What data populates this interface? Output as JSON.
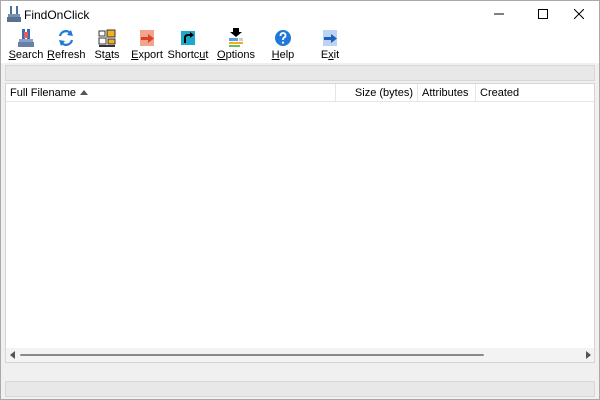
{
  "window": {
    "title": "FindOnClick"
  },
  "toolbar": {
    "buttons": [
      {
        "id": "search",
        "pre": "",
        "accel": "S",
        "post": "earch",
        "icon": "search-icon"
      },
      {
        "id": "refresh",
        "pre": "",
        "accel": "R",
        "post": "efresh",
        "icon": "refresh-icon"
      },
      {
        "id": "stats",
        "pre": "St",
        "accel": "a",
        "post": "ts",
        "icon": "stats-icon"
      },
      {
        "id": "export",
        "pre": "",
        "accel": "E",
        "post": "xport",
        "icon": "export-icon"
      },
      {
        "id": "shortcut",
        "pre": "Shortc",
        "accel": "u",
        "post": "t",
        "icon": "shortcut-icon"
      },
      {
        "id": "options",
        "pre": "",
        "accel": "O",
        "post": "ptions",
        "icon": "options-icon"
      },
      {
        "id": "help",
        "pre": "",
        "accel": "H",
        "post": "elp",
        "icon": "help-icon"
      },
      {
        "id": "exit",
        "pre": "E",
        "accel": "x",
        "post": "it",
        "icon": "exit-icon"
      }
    ]
  },
  "list": {
    "columns": {
      "name": "Full Filename",
      "size": "Size (bytes)",
      "attributes": "Attributes",
      "created": "Created"
    },
    "rows": []
  },
  "colors": {
    "window_bg": "#f0f0f0",
    "accent_blue": "#1e7ad6",
    "export_orange": "#e8643c"
  }
}
